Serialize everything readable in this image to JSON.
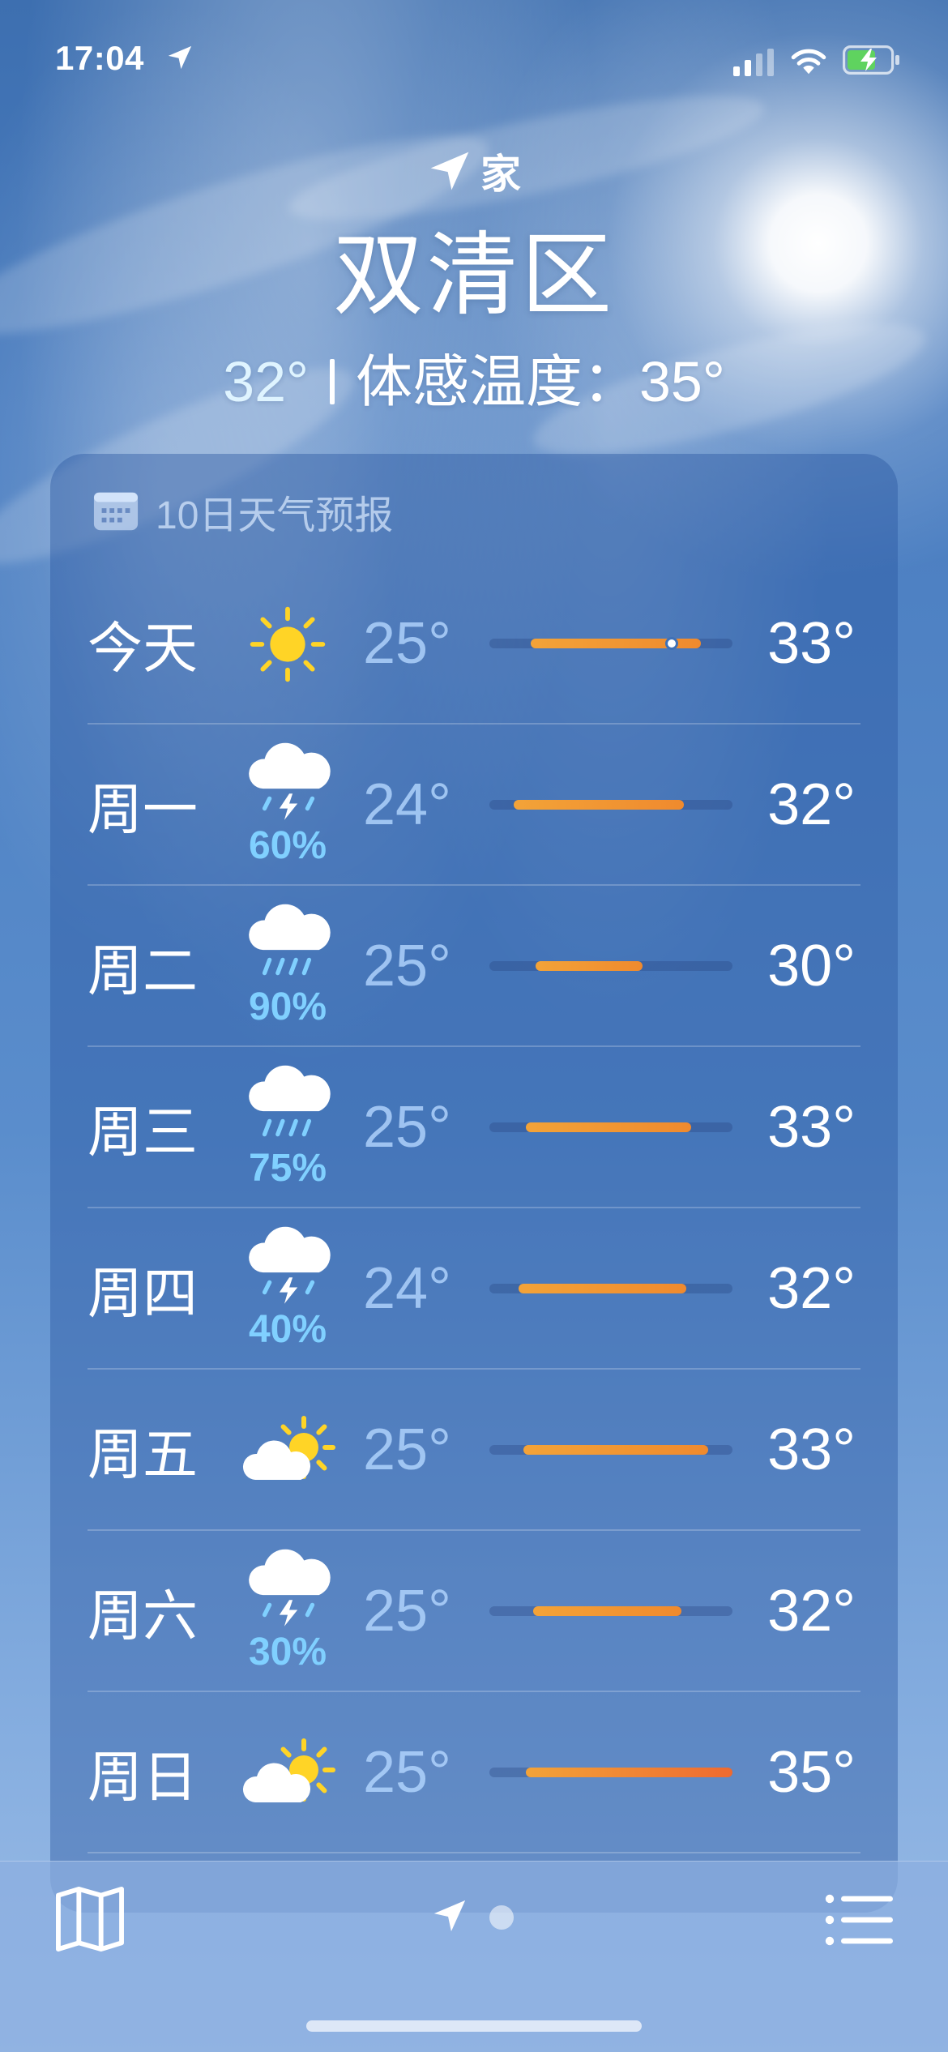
{
  "status_bar": {
    "time": "17:04"
  },
  "header": {
    "home_label": "家",
    "city": "双清区",
    "current_temp": "32°",
    "feels_like": "体感温度：35°"
  },
  "forecast": {
    "title": "10日天气预报",
    "days": [
      {
        "day": "今天",
        "icon": "sun-icon",
        "precip": "",
        "low": "25°",
        "high": "33°",
        "range_start": 0.17,
        "range_end": 0.87,
        "current": 0.75
      },
      {
        "day": "周一",
        "icon": "thunderstorm-icon",
        "precip": "60%",
        "low": "24°",
        "high": "32°",
        "range_start": 0.1,
        "range_end": 0.8
      },
      {
        "day": "周二",
        "icon": "rain-icon",
        "precip": "90%",
        "low": "25°",
        "high": "30°",
        "range_start": 0.19,
        "range_end": 0.63
      },
      {
        "day": "周三",
        "icon": "rain-icon",
        "precip": "75%",
        "low": "25°",
        "high": "33°",
        "range_start": 0.15,
        "range_end": 0.83
      },
      {
        "day": "周四",
        "icon": "thunderstorm-icon",
        "precip": "40%",
        "low": "24°",
        "high": "32°",
        "range_start": 0.12,
        "range_end": 0.81
      },
      {
        "day": "周五",
        "icon": "partly-cloudy-icon",
        "precip": "",
        "low": "25°",
        "high": "33°",
        "range_start": 0.14,
        "range_end": 0.9
      },
      {
        "day": "周六",
        "icon": "thunderstorm-icon",
        "precip": "30%",
        "low": "25°",
        "high": "32°",
        "range_start": 0.18,
        "range_end": 0.79
      },
      {
        "day": "周日",
        "icon": "partly-cloudy-icon",
        "precip": "",
        "low": "25°",
        "high": "35°",
        "range_start": 0.15,
        "range_end": 1.0
      }
    ]
  },
  "colors": {
    "precip_blue": "#80d0ff",
    "bar_orange": "#ef8a2e",
    "sun_yellow": "#ffd426"
  },
  "toolbar": {
    "map_icon": "map-icon",
    "location_icon": "location-arrow-icon",
    "list_icon": "list-icon"
  }
}
